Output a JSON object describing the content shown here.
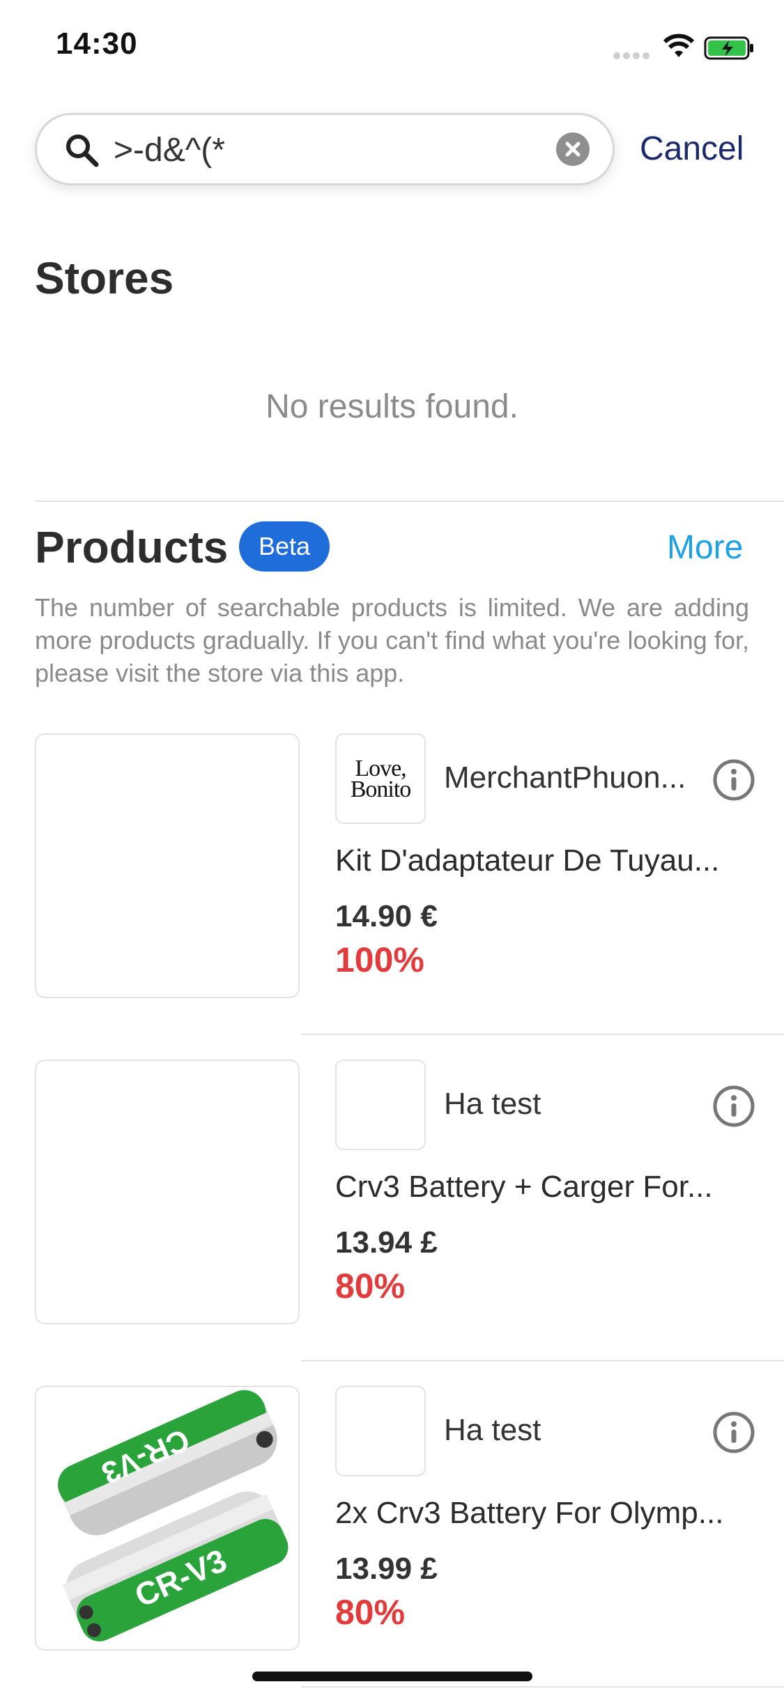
{
  "status_bar": {
    "time": "14:30"
  },
  "search": {
    "query": ">-d&^(*",
    "cancel_label": "Cancel"
  },
  "stores": {
    "title": "Stores",
    "empty_text": "No results found."
  },
  "products": {
    "title": "Products",
    "badge": "Beta",
    "more_label": "More",
    "description": "The number of searchable products is limited. We are adding more products gradually. If you can't find what you're looking for, please visit the store via this app.",
    "items": [
      {
        "merchant": "MerchantPhuon...",
        "merchant_logo_text": "Love, Bonito",
        "name": "Kit D'adaptateur De Tuyau...",
        "price": "14.90 €",
        "discount": "100%"
      },
      {
        "merchant": "Ha test",
        "name": "Crv3 Battery + Carger For...",
        "price": "13.94 £",
        "discount": "80%"
      },
      {
        "merchant": "Ha test",
        "name": "2x Crv3 Battery For Olymp...",
        "price": "13.99 £",
        "discount": "80%"
      }
    ]
  },
  "colors": {
    "accent": "#1e6ddb",
    "more": "#1da1e6",
    "discount": "#e23b3b",
    "cancel": "#1a2a6c"
  }
}
